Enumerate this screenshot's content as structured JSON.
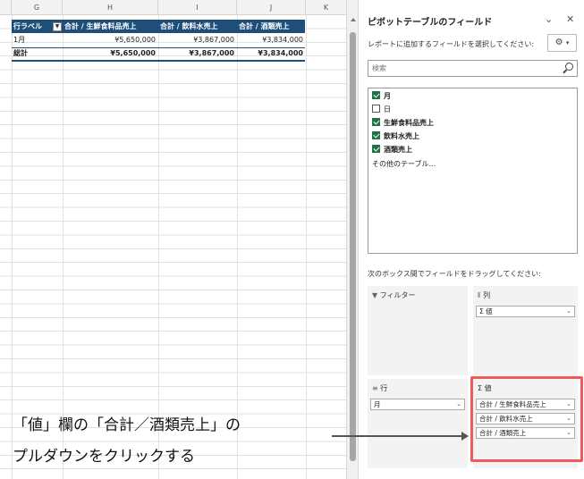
{
  "sheet": {
    "columns": [
      {
        "id": "G",
        "label": "G"
      },
      {
        "id": "H",
        "label": "H"
      },
      {
        "id": "I",
        "label": "I"
      },
      {
        "id": "J",
        "label": "J"
      },
      {
        "id": "K",
        "label": "K"
      }
    ],
    "pivot": {
      "headers": [
        "行ラベル",
        "合計 / 生鮮食料品売上",
        "合計 / 飲料水売上",
        "合計 / 酒類売上"
      ],
      "rows": [
        [
          "1月",
          "¥5,650,000",
          "¥3,867,000",
          "¥3,834,000"
        ]
      ],
      "total": [
        "総計",
        "¥5,650,000",
        "¥3,867,000",
        "¥3,834,000"
      ]
    }
  },
  "pane": {
    "title": "ピボットテーブルのフィールド",
    "subtitle": "レポートに追加するフィールドを選択してください:",
    "search_placeholder": "検索",
    "fields": [
      {
        "label": "月",
        "checked": true,
        "bold": true
      },
      {
        "label": "日",
        "checked": false,
        "bold": false
      },
      {
        "label": "生鮮食料品売上",
        "checked": true,
        "bold": true
      },
      {
        "label": "飲料水売上",
        "checked": true,
        "bold": true
      },
      {
        "label": "酒類売上",
        "checked": true,
        "bold": true
      }
    ],
    "more_tables": "その他のテーブル...",
    "drag_hint": "次のボックス間でフィールドをドラッグしてください:",
    "areas": {
      "filter": {
        "label": "フィルター",
        "icon": "filter-icon"
      },
      "columns": {
        "label": "列",
        "icon": "columns-icon",
        "items": [
          "Σ 値"
        ]
      },
      "rows": {
        "label": "行",
        "icon": "rows-icon",
        "items": [
          "月"
        ]
      },
      "values": {
        "label": "Σ 値",
        "icon": "sigma-icon",
        "items": [
          "合計 / 生鮮食料品売上",
          "合計 / 飲料水売上",
          "合計 / 酒類売上"
        ]
      }
    }
  },
  "annotation": {
    "line1": "「値」欄の「合計／酒類売上」の",
    "line2": "プルダウンをクリックする"
  },
  "colors": {
    "header_band": "#1f4e79",
    "checkbox": "#217346",
    "highlight": "#f05a5a"
  }
}
